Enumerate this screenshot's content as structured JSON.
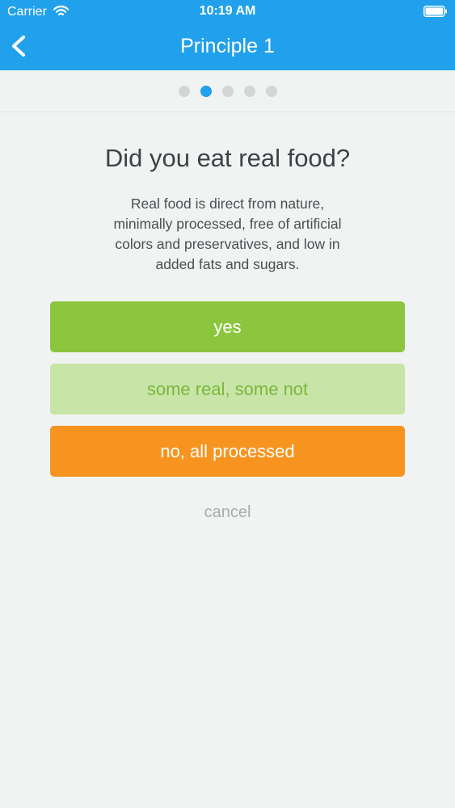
{
  "status_bar": {
    "carrier": "Carrier",
    "time": "10:19 AM",
    "wifi_icon": "wifi-icon",
    "battery_icon": "battery-icon"
  },
  "nav": {
    "back_icon": "chevron-left-icon",
    "title": "Principle 1"
  },
  "pager": {
    "total_pages": 5,
    "active_index": 1
  },
  "content": {
    "question": "Did you eat real food?",
    "description_lines": [
      "Real food is direct from nature,",
      "minimally processed, free of artificial",
      "colors and preservatives, and low in",
      "added fats and sugars."
    ]
  },
  "answers": {
    "yes": "yes",
    "some": "some real, some not",
    "no": "no, all processed"
  },
  "cancel_label": "cancel",
  "colors": {
    "header_blue": "#21a1ec",
    "yes_green": "#8cc63f",
    "some_light_green": "#c8e4a6",
    "no_orange": "#f7941f",
    "background": "#f1f2f2"
  }
}
